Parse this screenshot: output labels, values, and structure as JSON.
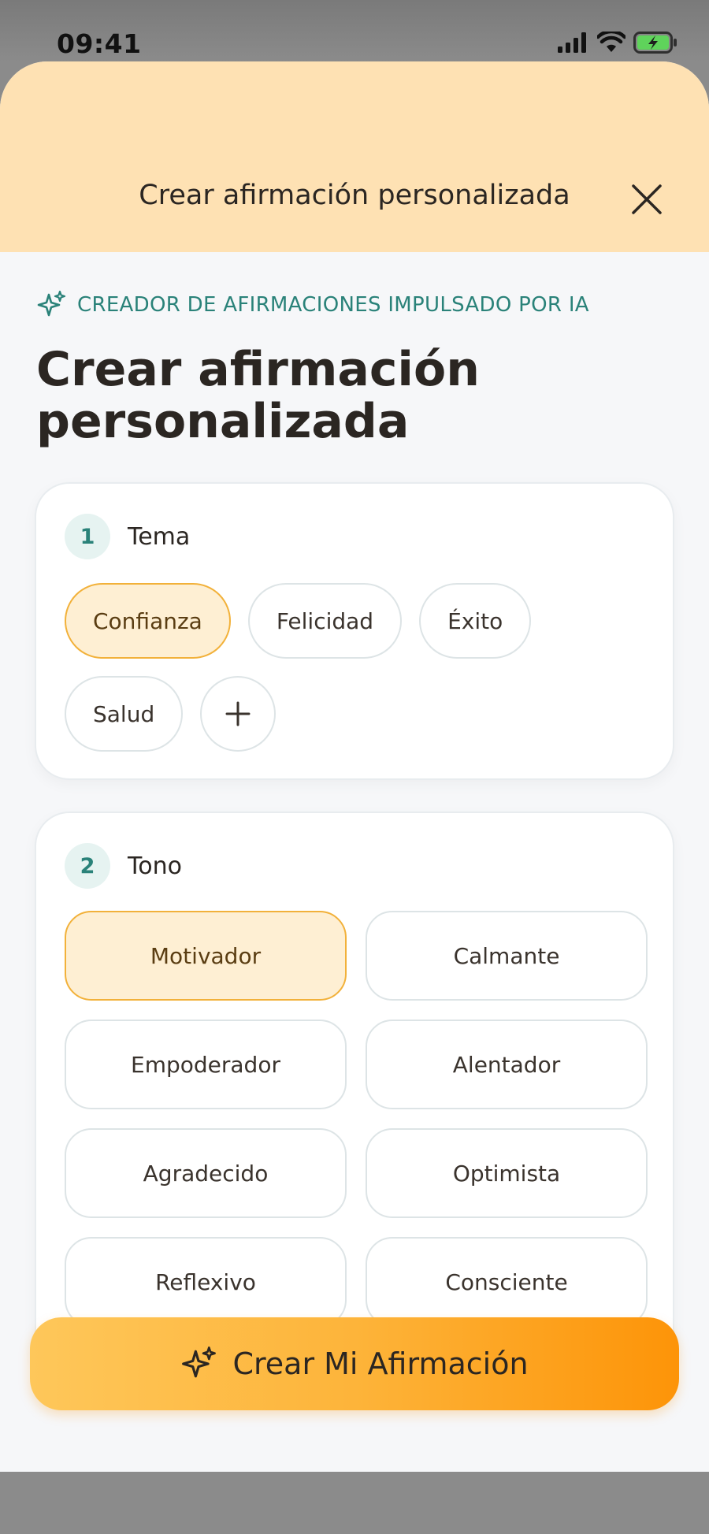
{
  "status_bar": {
    "time": "09:41"
  },
  "sheet": {
    "title": "Crear afirmación personalizada",
    "kicker": "CREADOR DE AFIRMACIONES IMPULSADO POR IA",
    "main_title": "Crear afirmación personalizada"
  },
  "theme_section": {
    "number": "1",
    "label": "Tema",
    "options": [
      {
        "label": "Confianza",
        "selected": true
      },
      {
        "label": "Felicidad",
        "selected": false
      },
      {
        "label": "Éxito",
        "selected": false
      },
      {
        "label": "Salud",
        "selected": false
      }
    ]
  },
  "tone_section": {
    "number": "2",
    "label": "Tono",
    "options": [
      {
        "label": "Motivador",
        "selected": true
      },
      {
        "label": "Calmante",
        "selected": false
      },
      {
        "label": "Empoderador",
        "selected": false
      },
      {
        "label": "Alentador",
        "selected": false
      },
      {
        "label": "Agradecido",
        "selected": false
      },
      {
        "label": "Optimista",
        "selected": false
      },
      {
        "label": "Reflexivo",
        "selected": false
      },
      {
        "label": "Consciente",
        "selected": false
      }
    ]
  },
  "cta": {
    "label": "Crear Mi Afirmación"
  },
  "colors": {
    "header_bg": "#fee1b3",
    "accent_teal": "#2a8279",
    "selected_bg": "#feefd3",
    "selected_border": "#f2b13a",
    "cta_start": "#fec75a",
    "cta_end": "#fd9408"
  }
}
